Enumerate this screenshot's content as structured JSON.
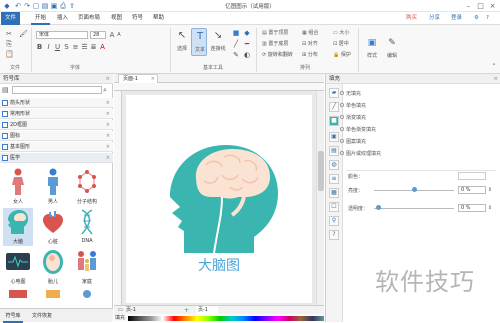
{
  "titlebar": {
    "title": "亿图图示（试用版）"
  },
  "menubar": {
    "items": [
      "文件",
      "开始",
      "插入",
      "页面布局",
      "视图",
      "符号",
      "帮助"
    ],
    "right": {
      "upgrade": "购买",
      "share": "分享",
      "login": "登录"
    }
  },
  "ribbon": {
    "groups": {
      "file": "文件",
      "font": "字体",
      "basic_tools": "基本工具",
      "arrange": "排列"
    },
    "font": {
      "family": "宋体",
      "size": "28"
    },
    "tools": {
      "select": "选择",
      "text": "文本",
      "connector": "连接线"
    },
    "arrange_items": [
      "置于顶层",
      "置于底层",
      "旋转和翻转",
      "组合",
      "对齐",
      "分布",
      "大小",
      "居中",
      "保护"
    ],
    "style": "样式",
    "edit": "编辑"
  },
  "library": {
    "title": "符号库",
    "categories": [
      "箭头形状",
      "常用形状",
      "2D框图",
      "图标",
      "基本图形",
      "医学"
    ],
    "shapes": [
      "女人",
      "男人",
      "分子结构",
      "大脑",
      "心脏",
      "DNA",
      "心电图",
      "胎儿",
      "家庭"
    ],
    "bottom_tabs": [
      "符号库",
      "文件恢复"
    ]
  },
  "canvas": {
    "tab": "页面-1",
    "title": "大脑图",
    "page_tabs": [
      "页-1",
      "页-1"
    ]
  },
  "rightpanel": {
    "title": "填充",
    "options": [
      "无填充",
      "单色填充",
      "渐变填充",
      "单色渐变填充",
      "图案填充",
      "图片或纹理填充"
    ],
    "color_label": "颜色：",
    "brightness_label": "亮度：",
    "brightness_value": "0 %",
    "transparency_label": "透明度：",
    "transparency_value": "0 %"
  },
  "statusbar": {
    "label": "填充"
  },
  "watermark": "软件技巧",
  "colors": {
    "accent": "#2f6fb5",
    "teal": "#3bb5b0",
    "brain": "#fbe3d4",
    "title": "#4aa5d8"
  }
}
